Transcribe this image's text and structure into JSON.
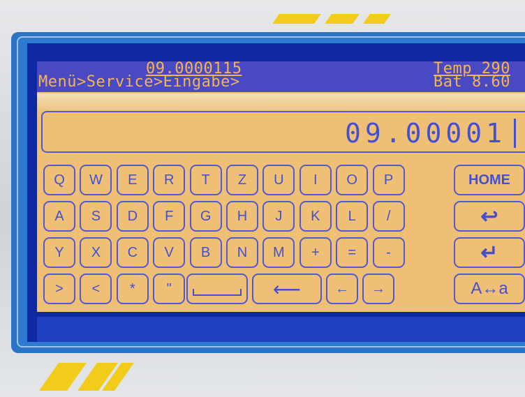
{
  "header": {
    "title": "09.0000115",
    "breadcrumb": "Menü>Service>Eingabe>",
    "temp": "Temp 290",
    "bat": "Bat 8.60"
  },
  "input": {
    "value": "09.00001"
  },
  "keys": {
    "row1": [
      "Q",
      "W",
      "E",
      "R",
      "T",
      "Z",
      "U",
      "I",
      "O",
      "P"
    ],
    "row2": [
      "A",
      "S",
      "D",
      "F",
      "G",
      "H",
      "J",
      "K",
      "L",
      "/"
    ],
    "row3": [
      "Y",
      "X",
      "C",
      "V",
      "B",
      "N",
      "M",
      "+",
      "=",
      "-"
    ],
    "row4": [
      ">",
      "<",
      "*",
      "\""
    ],
    "home": "HOME",
    "case": "A↔a",
    "back_icon": "↩",
    "enter_icon": "↵",
    "left": "←",
    "right": "→"
  }
}
